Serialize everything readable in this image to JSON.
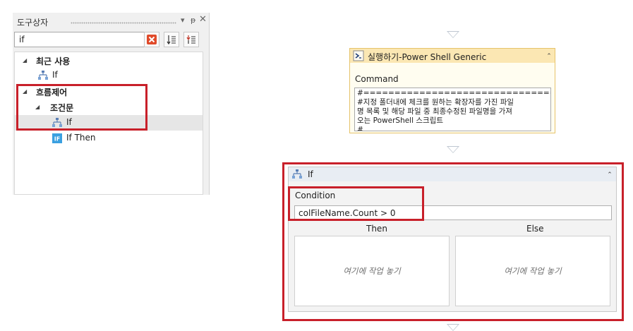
{
  "toolbox": {
    "title": "도구상자",
    "search_value": "if",
    "tree": [
      {
        "label": "최근 사용",
        "kind": "category",
        "expanded": true
      },
      {
        "label": "If",
        "kind": "activity"
      },
      {
        "label": "흐름제어",
        "kind": "category",
        "expanded": true
      },
      {
        "label": "조건문",
        "kind": "category",
        "expanded": true
      },
      {
        "label": "If",
        "kind": "activity",
        "selected": true
      },
      {
        "label": "If Then",
        "kind": "activity"
      }
    ]
  },
  "powershell_activity": {
    "title": "실행하기-Power Shell Generic",
    "command_label": "Command",
    "command_lines": [
      "#====================================",
      "#지정 폴더내에 체크를 원하는 확장자를 가진 파일",
      "명 목록 및 해당 파일 중 최종수정된 파일명을 가져",
      "오는 PowerShell 스크립트",
      "#"
    ]
  },
  "if_activity": {
    "title": "If",
    "condition_label": "Condition",
    "condition_value": "colFileName.Count > 0",
    "then_label": "Then",
    "else_label": "Else",
    "then_placeholder": "여기에 작업 놓기",
    "else_placeholder": "여기에 작업 놓기"
  },
  "colors": {
    "highlight": "#c8202a",
    "powershell_header": "#fbe7b3",
    "selection": "#e6e6e6"
  },
  "icons": [
    "pin-icon",
    "close-icon",
    "clear-search-icon",
    "sort-icon",
    "collapse-tree-icon",
    "if-activity-icon",
    "if-then-activity-icon",
    "powershell-icon",
    "collapse-chevron-icon"
  ]
}
